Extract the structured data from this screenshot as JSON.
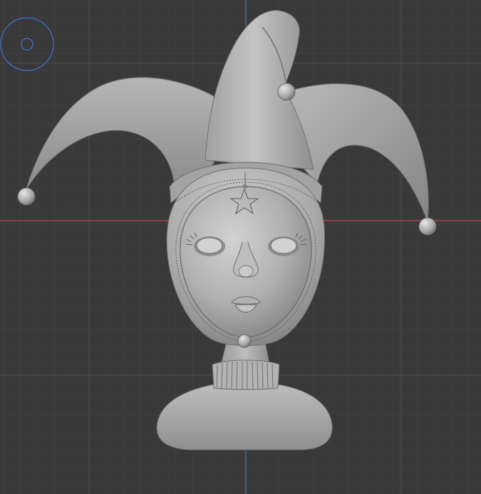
{
  "viewport": {
    "background_color": "#393939",
    "grid_minor_color": "#444444",
    "grid_major_color": "#4e4e4e",
    "x_axis_color": "#c4404e",
    "y_axis_color": "#3a6fc0",
    "camera_widget_color": "#3f76d6"
  },
  "model": {
    "subject": "jester-doll-head-bust",
    "base_color": "#b4b4b4",
    "shadow_color": "#6a6a6a",
    "highlight_color": "#d8d8d8",
    "stitch_color": "#555555"
  }
}
